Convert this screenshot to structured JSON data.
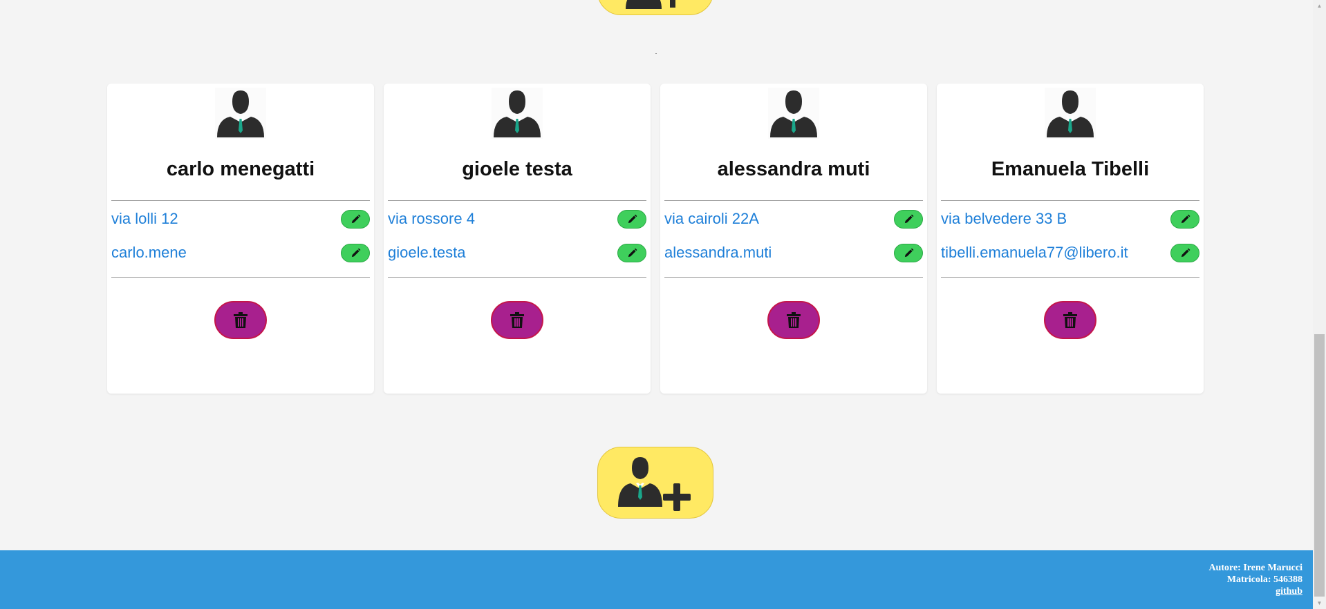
{
  "contacts": [
    {
      "name": "carlo menegatti",
      "address": "via lolli 12",
      "email": "carlo.mene"
    },
    {
      "name": "gioele testa",
      "address": "via rossore 4",
      "email": "gioele.testa"
    },
    {
      "name": "alessandra muti",
      "address": "via cairoli 22A",
      "email": "alessandra.muti"
    },
    {
      "name": "Emanuela Tibelli",
      "address": "via belvedere 33 B",
      "email": "tibelli.emanuela77@libero.it"
    }
  ],
  "footer": {
    "author": "Autore: Irene Marucci",
    "matricola": "Matricola: 546388",
    "github_link": "github"
  },
  "icons": {
    "avatar": "user-icon",
    "add": "add-user-icon",
    "edit": "pencil-icon",
    "delete": "trash-icon"
  },
  "colors": {
    "add_button": "#ffe963",
    "edit_button": "#3fcf5c",
    "delete_button": "#a8208e",
    "link_text": "#1e7fd8",
    "footer": "#3498db",
    "background": "#f4f4f4"
  }
}
